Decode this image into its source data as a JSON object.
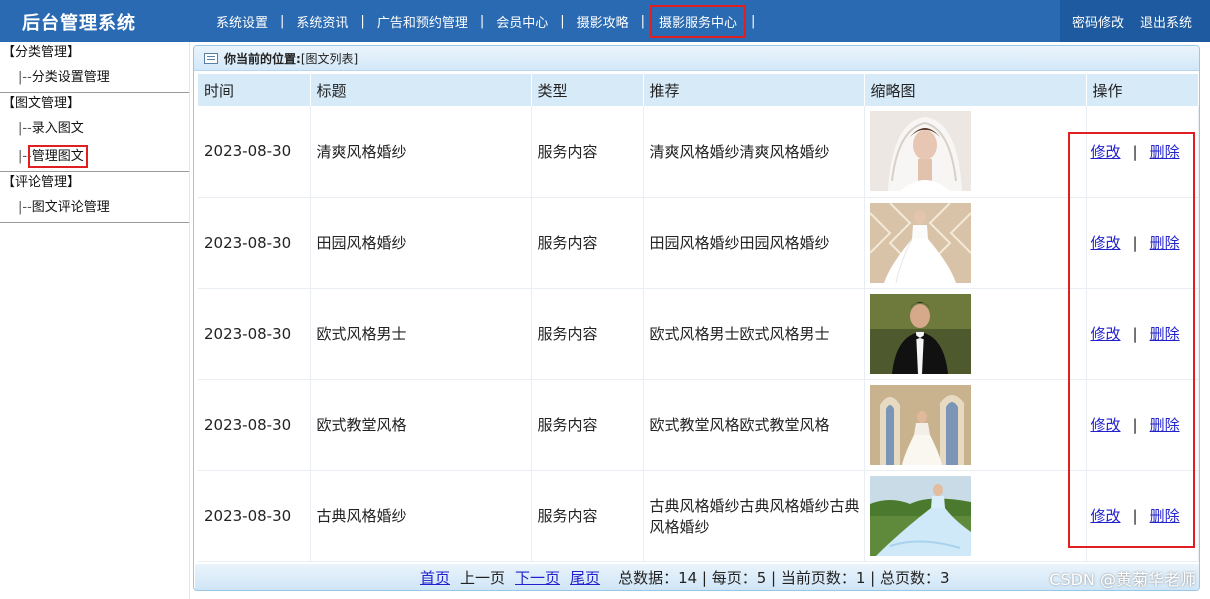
{
  "header": {
    "title": "后台管理系统",
    "nav": [
      "系统设置",
      "系统资讯",
      "广告和预约管理",
      "会员中心",
      "摄影攻略",
      "摄影服务中心"
    ],
    "sep": "|",
    "change_password": "密码修改",
    "logout": "退出系统"
  },
  "sidebar": {
    "groups": [
      {
        "title": "【分类管理】",
        "items": [
          "分类设置管理"
        ]
      },
      {
        "title": "【图文管理】",
        "items": [
          "录入图文",
          "管理图文"
        ]
      },
      {
        "title": "【评论管理】",
        "items": [
          "图文评论管理"
        ]
      }
    ],
    "item_prefix": "|--"
  },
  "breadcrumb": {
    "lead": "你当前的位置:",
    "current": "[图文列表]"
  },
  "table": {
    "headers": [
      "时间",
      "标题",
      "类型",
      "推荐",
      "缩略图",
      "操作"
    ],
    "rows": [
      {
        "time": "2023-08-30",
        "title": "清爽风格婚纱",
        "type": "服务内容",
        "rec": "清爽风格婚纱清爽风格婚纱",
        "thumb": "bride-lace-veil"
      },
      {
        "time": "2023-08-30",
        "title": "田园风格婚纱",
        "type": "服务内容",
        "rec": "田园风格婚纱田园风格婚纱",
        "thumb": "bride-garden-gown"
      },
      {
        "time": "2023-08-30",
        "title": "欧式风格男士",
        "type": "服务内容",
        "rec": "欧式风格男士欧式风格男士",
        "thumb": "groom-tuxedo"
      },
      {
        "time": "2023-08-30",
        "title": "欧式教堂风格",
        "type": "服务内容",
        "rec": "欧式教堂风格欧式教堂风格",
        "thumb": "church-bride"
      },
      {
        "time": "2023-08-30",
        "title": "古典风格婚纱",
        "type": "服务内容",
        "rec": "古典风格婚纱古典风格婚纱古典风格婚纱",
        "thumb": "classic-blue-gown"
      }
    ],
    "edit": "修改",
    "delete": "删除"
  },
  "pager": {
    "first": "首页",
    "prev": "上一页",
    "next": "下一页",
    "last": "尾页",
    "stats": "总数据：14 | 每页：5 | 当前页数：1 | 总页数：3"
  },
  "watermark": "CSDN @黄菊华老师"
}
